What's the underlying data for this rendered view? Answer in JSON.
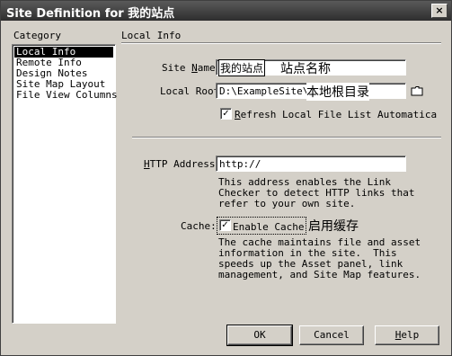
{
  "window": {
    "title": "Site Definition for 我的站点",
    "close": "×"
  },
  "category": {
    "heading": "Category",
    "items": [
      "Local Info",
      "Remote Info",
      "Design Notes",
      "Site Map Layout",
      "File View Columns"
    ],
    "selected_index": 0
  },
  "panel": {
    "heading": "Local Info",
    "site_name": {
      "label_pre": "Site ",
      "label_key": "N",
      "label_post": "ame:",
      "value": "我的站点",
      "annotation": "站点名称"
    },
    "local_root": {
      "label": "Local Root",
      "value": "D:\\ExampleSite\\",
      "annotation": "本地根目录",
      "folder_icon": "folder-icon"
    },
    "refresh": {
      "checked": true,
      "label_key": "R",
      "label_post": "efresh Local File List Automatica"
    },
    "http": {
      "label_key": "H",
      "label_post": "TTP Address:",
      "value": "http://",
      "description": "This address enables the Link\nChecker to detect HTTP links that\nrefer to your own site."
    },
    "cache": {
      "label": "Cache:",
      "checked": true,
      "checkbox_label": "Enable Cache",
      "annotation": "启用缓存",
      "description": "The cache maintains file and asset\ninformation in the site.  This\nspeeds up the Asset panel, link\nmanagement, and Site Map features."
    }
  },
  "buttons": {
    "ok": "OK",
    "cancel": "Cancel",
    "help_key": "H",
    "help_post": "elp"
  }
}
